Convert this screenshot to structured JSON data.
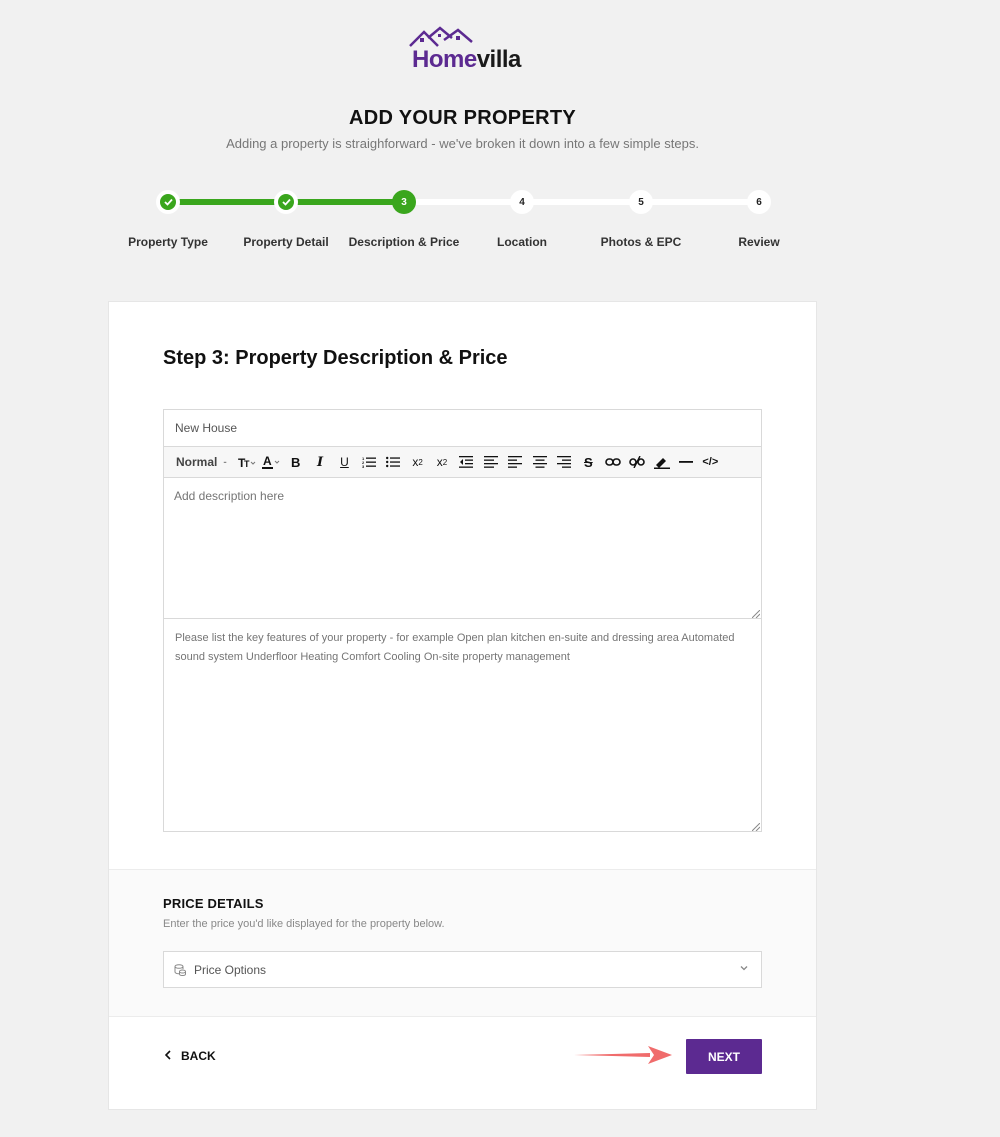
{
  "brand": {
    "home": "Home",
    "villa": "villa",
    "color_primary": "#5c2a91"
  },
  "header": {
    "title": "ADD YOUR PROPERTY",
    "subtitle": "Adding a property is straighforward - we've broken it down into a few simple steps."
  },
  "stepper": {
    "steps": [
      {
        "number": "1",
        "label": "Property Type",
        "status": "done"
      },
      {
        "number": "2",
        "label": "Property Detail",
        "status": "done"
      },
      {
        "number": "3",
        "label": "Description & Price",
        "status": "current"
      },
      {
        "number": "4",
        "label": "Location",
        "status": "todo"
      },
      {
        "number": "5",
        "label": "Photos & EPC",
        "status": "todo"
      },
      {
        "number": "6",
        "label": "Review",
        "status": "todo"
      }
    ],
    "color_done": "#3aa61d"
  },
  "form": {
    "title": "Step 3: Property Description & Price",
    "property_title": {
      "value": "New House"
    },
    "editor": {
      "format_label": "Normal",
      "tools": [
        "text-size",
        "font-color",
        "bold",
        "italic",
        "underline",
        "ordered-list",
        "bullet-list",
        "subscript",
        "superscript",
        "outdent",
        "indent",
        "align-left",
        "align-center",
        "align-right",
        "strikethrough",
        "link",
        "unlink",
        "highlighter",
        "horizontal-rule",
        "code"
      ]
    },
    "description": {
      "placeholder": "Add description here",
      "value": ""
    },
    "features": {
      "placeholder": "Please list the key features of your property - for example Open plan kitchen en-suite and dressing area Automated sound system Underfloor Heating Comfort Cooling On-site property management"
    }
  },
  "price": {
    "title": "PRICE DETAILS",
    "subtitle": "Enter the price you'd like displayed for the property below.",
    "select_label": "Price Options",
    "icon": "coins-icon"
  },
  "actions": {
    "back_label": "BACK",
    "next_label": "NEXT"
  }
}
